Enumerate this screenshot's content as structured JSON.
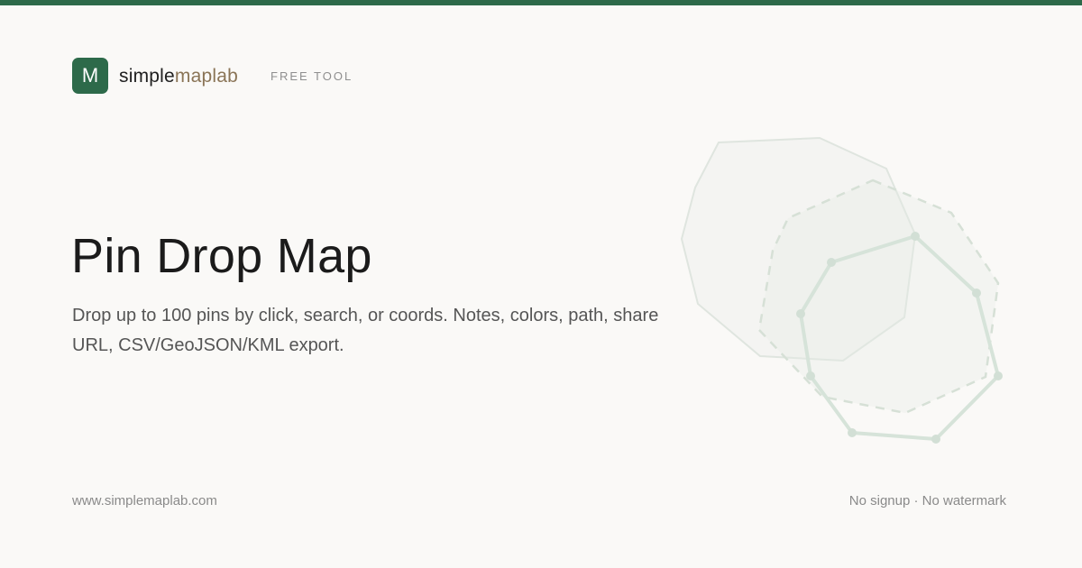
{
  "header": {
    "logo_letter": "M",
    "brand_part1": "simple",
    "brand_part2": "maplab",
    "tag": "FREE TOOL"
  },
  "hero": {
    "title": "Pin Drop Map",
    "description": "Drop up to 100 pins by click, search, or coords. Notes, colors, path, share URL, CSV/GeoJSON/KML export."
  },
  "footer": {
    "website": "www.simplemaplab.com",
    "features": "No signup · No watermark"
  },
  "colors": {
    "accent": "#2d6a4a",
    "brand_secondary": "#8a7456",
    "background": "#faf9f7"
  }
}
